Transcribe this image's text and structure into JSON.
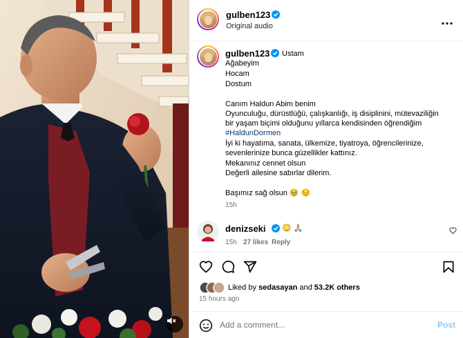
{
  "media": {
    "mute_icon": "speaker-muted-icon"
  },
  "header": {
    "username": "gulben123",
    "verified": true,
    "audio_label": "Original audio",
    "more_icon": "more-horizontal-icon"
  },
  "caption": {
    "username": "gulben123",
    "first_line": "Ustam",
    "lines": [
      "Ağabeyim",
      "Hocam",
      "Dostum",
      "",
      "Canım Haldun Abim benim",
      "Oyunculuğu, dürüstlüğü, çalışkanlığı, iş disiplinini, mütevaziliğin",
      "bir yaşam biçimi olduğunu yıllarca kendisinden öğrendiğim",
      "#HaldunDormen",
      "İyi ki hayatıma, sanata, ülkemize, tiyatroya, öğrencilerinize,",
      "sevenlerinize bunca güzellikler kattınız.",
      "Mekanınız cennet olsun",
      "Değerli ailesine sabırlar dilerim.",
      "",
      "Başımız sağ olsun 🥹 😔"
    ],
    "time": "15h"
  },
  "comment": {
    "username": "denizseki",
    "verified": true,
    "text": "😳 🙏🏼",
    "time": "15h",
    "likes": "27 likes",
    "reply": "Reply"
  },
  "actions": {
    "like_icon": "heart-icon",
    "comment_icon": "comment-icon",
    "share_icon": "share-icon",
    "save_icon": "bookmark-icon"
  },
  "likes": {
    "prefix": "Liked by",
    "user": "sedasayan",
    "and": "and",
    "others": "53.2K others"
  },
  "posted": "15 hours ago",
  "add_comment": {
    "placeholder": "Add a comment...",
    "post_label": "Post",
    "emoji_icon": "emoji-icon"
  },
  "colors": {
    "verified_blue": "#0095f6",
    "hashtag": "#00376b",
    "muted_text": "#737373",
    "post_button": "#90c6f7"
  }
}
